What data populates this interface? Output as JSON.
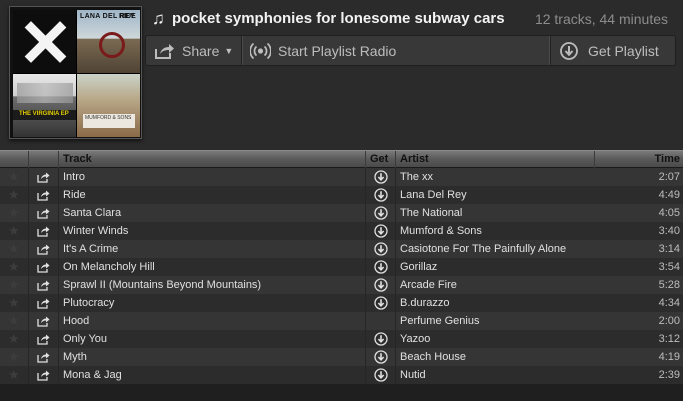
{
  "playlist": {
    "title": "pocket symphonies for lonesome subway cars",
    "meta": "12 tracks, 44 minutes"
  },
  "covers": {
    "cover2_text_left": "LANA DEL REY",
    "cover2_text_right": "RIDE",
    "cover3_text": "THE VIRGINIA EP",
    "cover4_text": "MUMFORD & SONS"
  },
  "toolbar": {
    "share_label": "Share",
    "radio_label": "Start Playlist Radio",
    "get_label": "Get Playlist"
  },
  "table": {
    "headers": {
      "track": "Track",
      "get": "Get",
      "artist": "Artist",
      "time": "Time"
    },
    "rows": [
      {
        "track": "Intro",
        "artist": "The xx",
        "time": "2:07",
        "downloadable": true
      },
      {
        "track": "Ride",
        "artist": "Lana Del Rey",
        "time": "4:49",
        "downloadable": true
      },
      {
        "track": "Santa Clara",
        "artist": "The National",
        "time": "4:05",
        "downloadable": true
      },
      {
        "track": "Winter Winds",
        "artist": "Mumford & Sons",
        "time": "3:40",
        "downloadable": true
      },
      {
        "track": "It's A Crime",
        "artist": "Casiotone For The Painfully Alone",
        "time": "3:14",
        "downloadable": true
      },
      {
        "track": "On Melancholy Hill",
        "artist": "Gorillaz",
        "time": "3:54",
        "downloadable": true
      },
      {
        "track": "Sprawl II (Mountains Beyond Mountains)",
        "artist": "Arcade Fire",
        "time": "5:28",
        "downloadable": true
      },
      {
        "track": "Plutocracy",
        "artist": "B.durazzo",
        "time": "4:34",
        "downloadable": true
      },
      {
        "track": "Hood",
        "artist": "Perfume Genius",
        "time": "2:00",
        "downloadable": false
      },
      {
        "track": "Only You",
        "artist": "Yazoo",
        "time": "3:12",
        "downloadable": true
      },
      {
        "track": "Myth",
        "artist": "Beach House",
        "time": "4:19",
        "downloadable": true
      },
      {
        "track": "Mona & Jag",
        "artist": "Nutid",
        "time": "2:39",
        "downloadable": true
      }
    ]
  }
}
